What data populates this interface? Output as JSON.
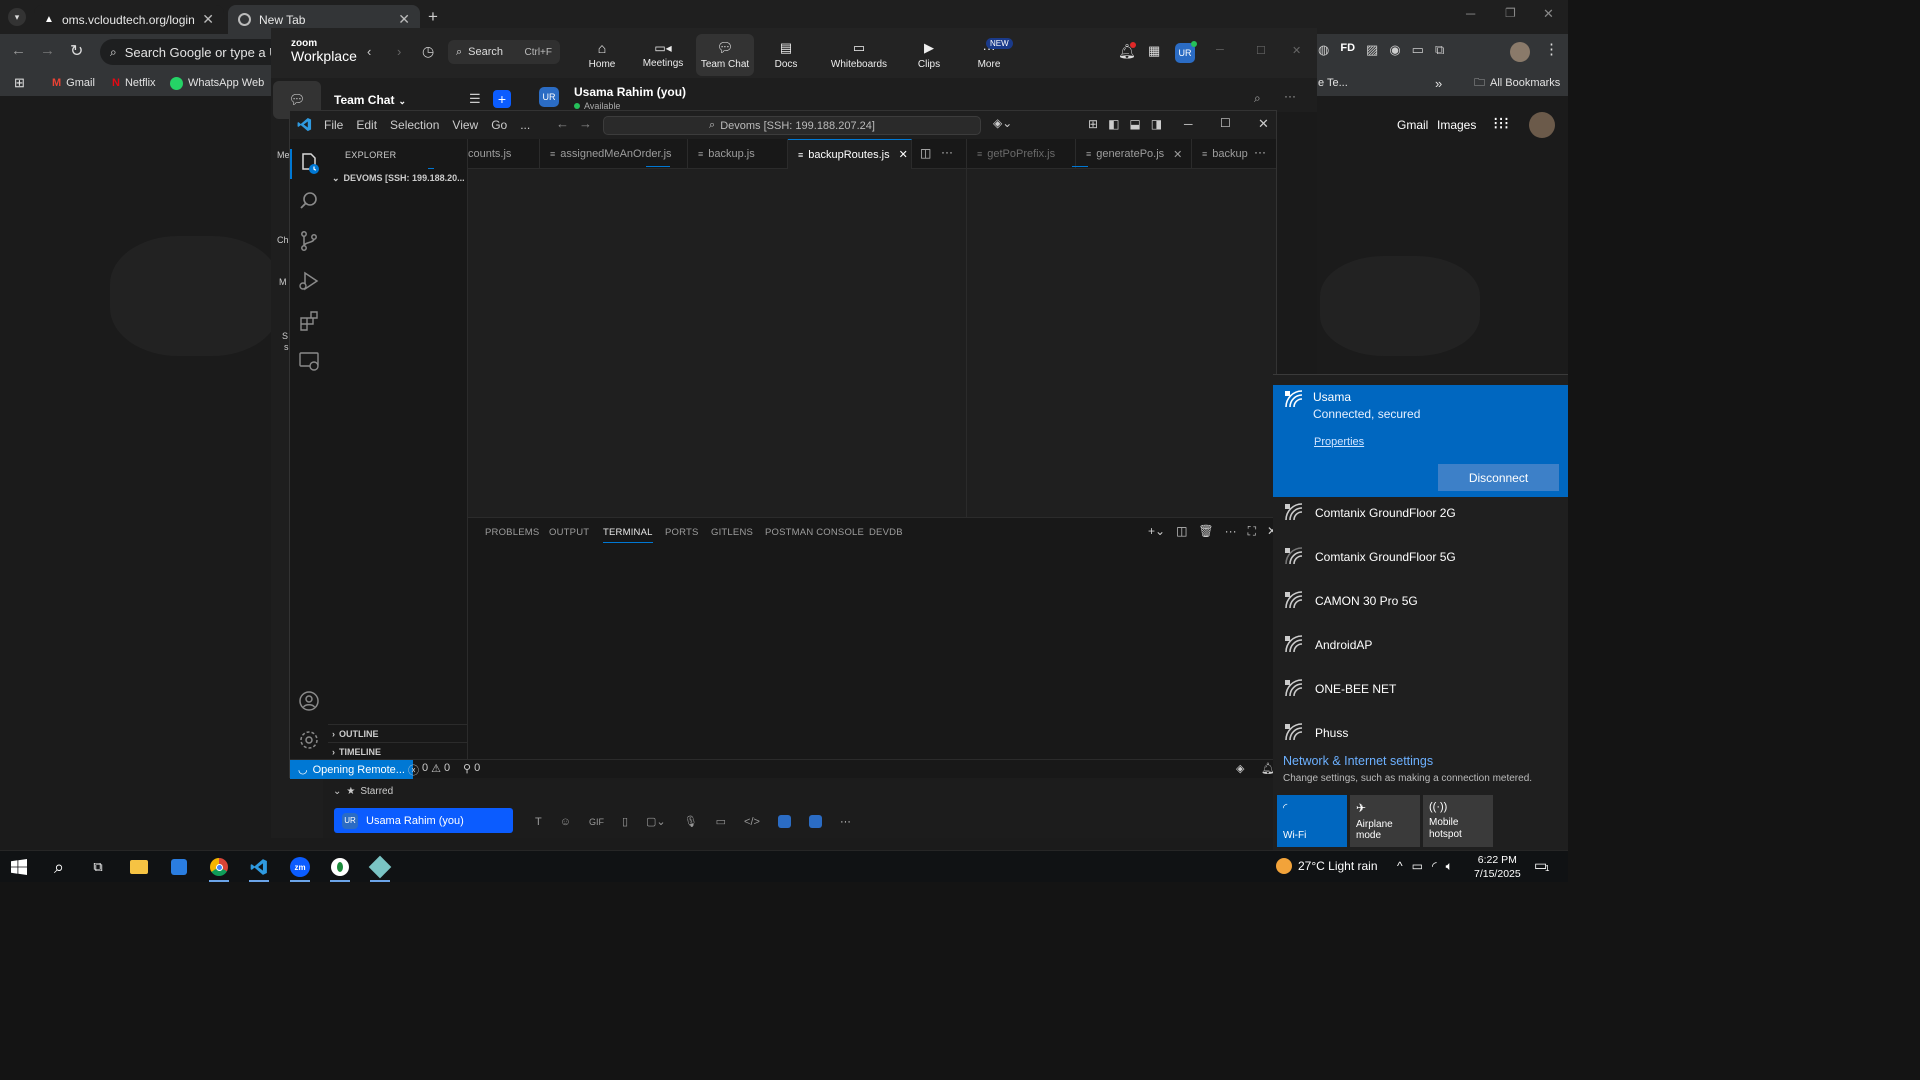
{
  "browser": {
    "tabs": [
      {
        "title": "oms.vcloudtech.org/login"
      },
      {
        "title": "New Tab"
      }
    ],
    "omnibox_placeholder": "Search Google or type a URL",
    "bookmarks": [
      {
        "label": "Gmail"
      },
      {
        "label": "Netflix"
      },
      {
        "label": "WhatsApp Web"
      }
    ],
    "bookmark_partial": "e Te...",
    "all_bookmarks": "All Bookmarks",
    "google_links": {
      "gmail": "Gmail",
      "images": "Images"
    },
    "profile_initials": "FD"
  },
  "zoom": {
    "brand_top": "zoom",
    "brand_bottom": "Workplace",
    "search_label": "Search",
    "search_shortcut": "Ctrl+F",
    "nav": [
      {
        "label": "Home",
        "icon": "home-icon"
      },
      {
        "label": "Meetings",
        "icon": "video-icon"
      },
      {
        "label": "Team Chat",
        "icon": "chat-icon"
      },
      {
        "label": "Docs",
        "icon": "doc-icon"
      },
      {
        "label": "Whiteboards",
        "icon": "whiteboard-icon"
      },
      {
        "label": "Clips",
        "icon": "clips-icon"
      },
      {
        "label": "More",
        "icon": "more-icon"
      }
    ],
    "new_badge": "NEW",
    "avatar_initials": "UR",
    "panel_title": "Team Chat",
    "chat_user": "Usama Rahim (you)",
    "chat_status": "Available",
    "left_rail_partial": [
      "Me",
      "Ch",
      "M",
      "S",
      "s"
    ],
    "starred_label": "Starred",
    "starred_user": "Usama Rahim (you)"
  },
  "vscode": {
    "menu": [
      "File",
      "Edit",
      "Selection",
      "View",
      "Go",
      "..."
    ],
    "command_center": "Devoms [SSH: 199.188.207.24]",
    "explorer_title": "EXPLORER",
    "workspace": "DEVOMS [SSH: 199.188.20...",
    "outline": "OUTLINE",
    "timeline": "TIMELINE",
    "tabs_left": [
      {
        "label": "counts.js",
        "state": "normal"
      },
      {
        "label": "assignedMeAnOrder.js",
        "state": "normal"
      },
      {
        "label": "backup.js",
        "state": "normal"
      },
      {
        "label": "backupRoutes.js",
        "state": "active"
      }
    ],
    "tabs_right": [
      {
        "label": "getPoPrefix.js",
        "state": "dim"
      },
      {
        "label": "generatePo.js",
        "state": "normal"
      },
      {
        "label": "backup",
        "state": "normal"
      }
    ],
    "panel_tabs": [
      "PROBLEMS",
      "OUTPUT",
      "TERMINAL",
      "PORTS",
      "GITLENS",
      "POSTMAN CONSOLE",
      "DEVDB"
    ],
    "active_panel_tab": "TERMINAL",
    "status": {
      "remote": "Opening Remote...",
      "errors": "0",
      "warnings": "0",
      "ports": "0"
    }
  },
  "wifi": {
    "connected": {
      "ssid": "Usama",
      "status": "Connected, secured",
      "properties": "Properties",
      "disconnect": "Disconnect"
    },
    "networks": [
      "Comtanix GroundFloor 2G",
      "Comtanix GroundFloor 5G",
      "CAMON 30 Pro 5G",
      "AndroidAP",
      "ONE-BEE NET",
      "Phuss"
    ],
    "settings_title": "Network & Internet settings",
    "settings_desc": "Change settings, such as making a connection metered.",
    "quick_actions": [
      {
        "label": "Wi-Fi",
        "active": true
      },
      {
        "label": "Airplane mode",
        "active": false
      },
      {
        "label": "Mobile hotspot",
        "active": false
      }
    ]
  },
  "taskbar": {
    "weather": "27°C  Light rain",
    "time": "6:22 PM",
    "date": "7/15/2025",
    "notif_count": "1"
  },
  "colors": {
    "vscode_blue": "#0078d4",
    "wifi_blue": "#0067c0",
    "zoom_blue": "#0b5cff"
  }
}
